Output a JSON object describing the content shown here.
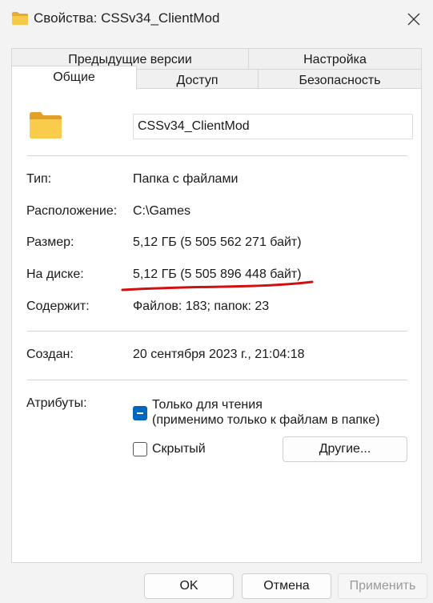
{
  "window": {
    "title": "Свойства: CSSv34_ClientMod",
    "folder_icon": "folder-icon",
    "close_icon": "close-icon"
  },
  "tabs": {
    "row_back": [
      "Предыдущие версии",
      "Настройка"
    ],
    "row_front": [
      "Общие",
      "Доступ",
      "Безопасность"
    ],
    "active": "Общие"
  },
  "general": {
    "name": "CSSv34_ClientMod",
    "type_label": "Тип:",
    "type_value": "Папка с файлами",
    "location_label": "Расположение:",
    "location_value": "C:\\Games",
    "size_label": "Размер:",
    "size_value": "5,12 ГБ (5 505 562 271 байт)",
    "ondisk_label": "На диске:",
    "ondisk_value": "5,12 ГБ (5 505 896 448 байт)",
    "contains_label": "Содержит:",
    "contains_value": "Файлов: 183; папок: 23",
    "created_label": "Создан:",
    "created_value": "20 сентября 2023 г., 21:04:18",
    "attributes_label": "Атрибуты:",
    "readonly_line1": "Только для чтения",
    "readonly_line2": "(применимо только к файлам в папке)",
    "readonly_state": "indeterminate",
    "hidden_label": "Скрытый",
    "hidden_checked": false,
    "advanced_button": "Другие..."
  },
  "footer": {
    "ok": "OK",
    "cancel": "Отмена",
    "apply": "Применить",
    "apply_enabled": false
  },
  "colors": {
    "accent": "#0067c0",
    "annotation": "#d01010",
    "folder": "#f5c242"
  }
}
